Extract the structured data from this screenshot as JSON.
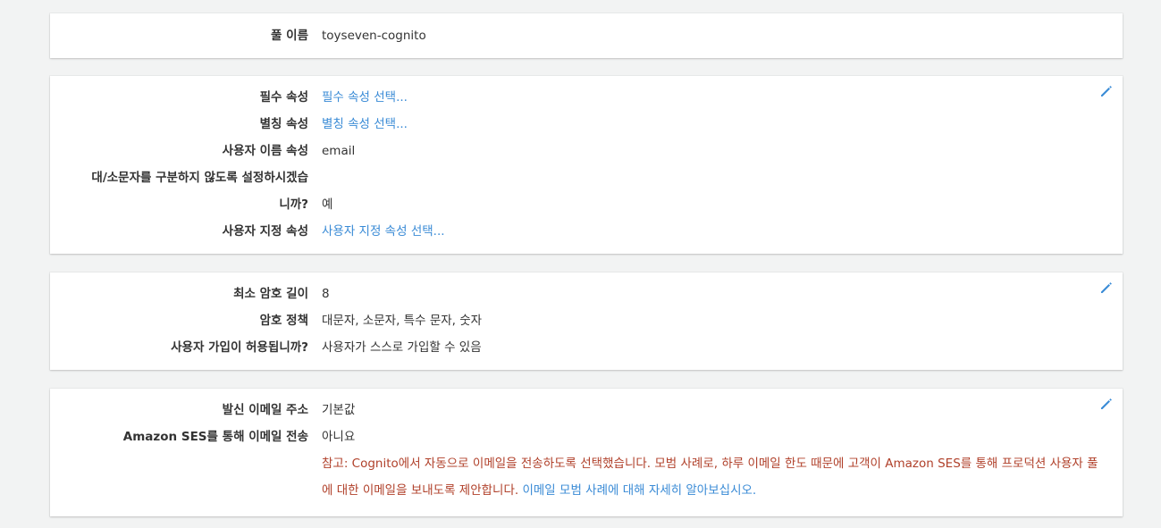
{
  "pool": {
    "name_label": "풀 이름",
    "name_value": "toyseven-cognito"
  },
  "attributes": {
    "required_label": "필수 속성",
    "required_value": "필수 속성 선택...",
    "alias_label": "별칭 속성",
    "alias_value": "별칭 속성 선택...",
    "username_label": "사용자 이름 속성",
    "username_value": "email",
    "case_label_line1": "대/소문자를 구분하지 않도록 설정하시겠습",
    "case_label_line2": "니까?",
    "case_value": "예",
    "custom_label": "사용자 지정 속성",
    "custom_value": "사용자 지정 속성 선택..."
  },
  "password": {
    "min_length_label": "최소 암호 길이",
    "min_length_value": "8",
    "policy_label": "암호 정책",
    "policy_value": "대문자, 소문자, 특수 문자, 숫자",
    "signup_label": "사용자 가입이 허용됩니까?",
    "signup_value": "사용자가 스스로 가입할 수 있음"
  },
  "email": {
    "from_label": "발신 이메일 주소",
    "from_value": "기본값",
    "ses_label": "Amazon SES를 통해 이메일 전송",
    "ses_value": "아니요",
    "note_text": "참고: Cognito에서 자동으로 이메일을 전송하도록 선택했습니다. 모범 사례로, 하루 이메일 한도 때문에 고객이 Amazon SES를 통해 프로덕션 사용자 풀에 대한 이메일을 보내도록 제안합니다. ",
    "note_link": "이메일 모범 사례에 대해 자세히 알아보십시오."
  },
  "colors": {
    "link": "#3a8bd6",
    "note": "#b0402a",
    "edit_icon": "#3a8bd6"
  },
  "icons": {
    "edit": "pencil-icon"
  }
}
